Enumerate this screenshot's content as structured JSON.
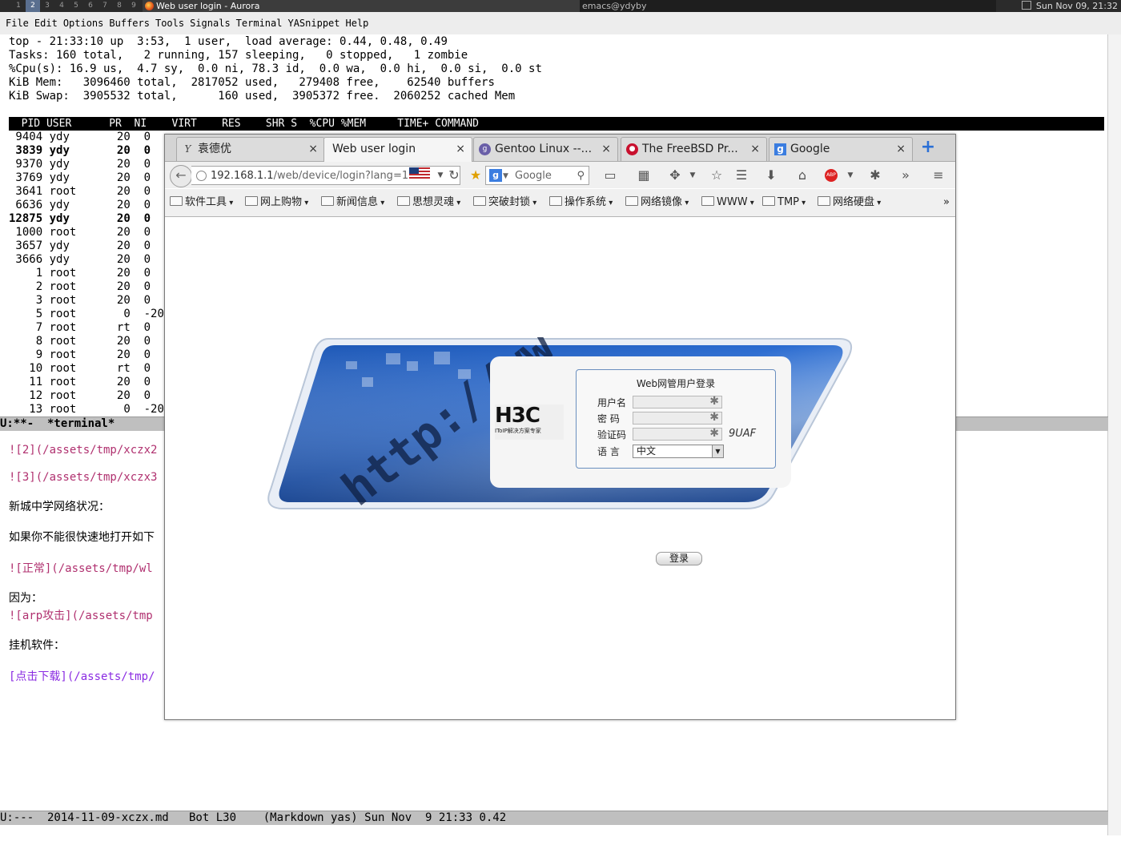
{
  "panel": {
    "workspaces": [
      "1",
      "2",
      "3",
      "4",
      "5",
      "6",
      "7",
      "8",
      "9"
    ],
    "active_window_title": "Web user login - Aurora",
    "other_window_title": "emacs@ydyby",
    "clock": "Sun Nov 09, 21:32"
  },
  "emacs_menu": [
    "File",
    "Edit",
    "Options",
    "Buffers",
    "Tools",
    "Signals",
    "Terminal",
    "YASnippet",
    "Help"
  ],
  "top": {
    "summary": [
      "top - 21:33:10 up  3:53,  1 user,  load average: 0.44, 0.48, 0.49",
      "Tasks: 160 total,   2 running, 157 sleeping,   0 stopped,   1 zombie",
      "%Cpu(s): 16.9 us,  4.7 sy,  0.0 ni, 78.3 id,  0.0 wa,  0.0 hi,  0.0 si,  0.0 st",
      "KiB Mem:   3096460 total,  2817052 used,   279408 free,    62540 buffers",
      "KiB Swap:  3905532 total,      160 used,  3905372 free.  2060252 cached Mem"
    ],
    "header": "  PID USER      PR  NI    VIRT    RES    SHR S  %CPU %MEM     TIME+ COMMAND",
    "rows": [
      {
        "pid": " 9404",
        "user": "ydy ",
        "pr": "20",
        "ni": "0",
        "bold": false
      },
      {
        "pid": " 3839",
        "user": "ydy ",
        "pr": "20",
        "ni": "0",
        "bold": true
      },
      {
        "pid": " 9370",
        "user": "ydy ",
        "pr": "20",
        "ni": "0",
        "bold": false
      },
      {
        "pid": " 3769",
        "user": "ydy ",
        "pr": "20",
        "ni": "0",
        "bold": false
      },
      {
        "pid": " 3641",
        "user": "root",
        "pr": "20",
        "ni": "0",
        "bold": false
      },
      {
        "pid": " 6636",
        "user": "ydy ",
        "pr": "20",
        "ni": "0",
        "bold": false
      },
      {
        "pid": "12875",
        "user": "ydy ",
        "pr": "20",
        "ni": "0",
        "bold": true
      },
      {
        "pid": " 1000",
        "user": "root",
        "pr": "20",
        "ni": "0",
        "bold": false
      },
      {
        "pid": " 3657",
        "user": "ydy ",
        "pr": "20",
        "ni": "0",
        "bold": false
      },
      {
        "pid": " 3666",
        "user": "ydy ",
        "pr": "20",
        "ni": "0",
        "bold": false
      },
      {
        "pid": "    1",
        "user": "root",
        "pr": "20",
        "ni": "0",
        "bold": false
      },
      {
        "pid": "    2",
        "user": "root",
        "pr": "20",
        "ni": "0",
        "bold": false
      },
      {
        "pid": "    3",
        "user": "root",
        "pr": "20",
        "ni": "0",
        "bold": false
      },
      {
        "pid": "    5",
        "user": "root",
        "pr": " 0",
        "ni": "-20",
        "bold": false
      },
      {
        "pid": "    7",
        "user": "root",
        "pr": "rt",
        "ni": "0",
        "bold": false
      },
      {
        "pid": "    8",
        "user": "root",
        "pr": "20",
        "ni": "0",
        "bold": false
      },
      {
        "pid": "    9",
        "user": "root",
        "pr": "20",
        "ni": "0",
        "bold": false
      },
      {
        "pid": "   10",
        "user": "root",
        "pr": "rt",
        "ni": "0",
        "bold": false
      },
      {
        "pid": "   11",
        "user": "root",
        "pr": "20",
        "ni": "0",
        "bold": false
      },
      {
        "pid": "   12",
        "user": "root",
        "pr": "20",
        "ni": "0",
        "bold": false
      },
      {
        "pid": "   13",
        "user": "root",
        "pr": " 0",
        "ni": "-20",
        "bold": false
      }
    ]
  },
  "modeline_terminal": "U:**-  *terminal*",
  "markdown": {
    "l1": "![2](/assets/tmp/xczx2",
    "l2": "![3](/assets/tmp/xczx3",
    "l3": "新城中学网络状况：",
    "l4": "如果你不能很快速地打开如下",
    "l5": "![正常](/assets/tmp/wl",
    "l6": "因为：",
    "l7": "![arp攻击](/assets/tmp",
    "l8": "挂机软件：",
    "l9": "[点击下载](/assets/tmp/"
  },
  "modeline_bottom": "U:---  2014-11-09-xczx.md   Bot L30    (Markdown yas) Sun Nov  9 21:33 0.42",
  "firefox": {
    "tabs": [
      {
        "label": "袁德优",
        "icon": "y-icon"
      },
      {
        "label": "Web user login",
        "icon": "blank-page-icon"
      },
      {
        "label": "Gentoo Linux --...",
        "icon": "gentoo-icon"
      },
      {
        "label": "The FreeBSD Pr...",
        "icon": "freebsd-icon"
      },
      {
        "label": "Google",
        "icon": "google-icon"
      }
    ],
    "tab_close": "×",
    "new_tab": "+",
    "url_host": "192.168.1.1",
    "url_path": "/web/device/login?lang=1",
    "search_placeholder": "Google",
    "bookmarks": [
      "软件工具",
      "网上购物",
      "新闻信息",
      "思想灵魂",
      "突破封锁",
      "操作系统",
      "网络镜像",
      "WWW",
      "TMP",
      "网络硬盘"
    ],
    "bookmarks_overflow": "»"
  },
  "login": {
    "brand": "H3C",
    "brand_sub": "IToIP解决方案专家",
    "banner_text": "http://ww",
    "form_title": "Web网管用户登录",
    "username_label": "用户名",
    "password_label": "密  码",
    "captcha_label": "验证码",
    "captcha_value": "9UAF",
    "language_label": "语  言",
    "language_value": "中文",
    "login_button": "登录"
  }
}
